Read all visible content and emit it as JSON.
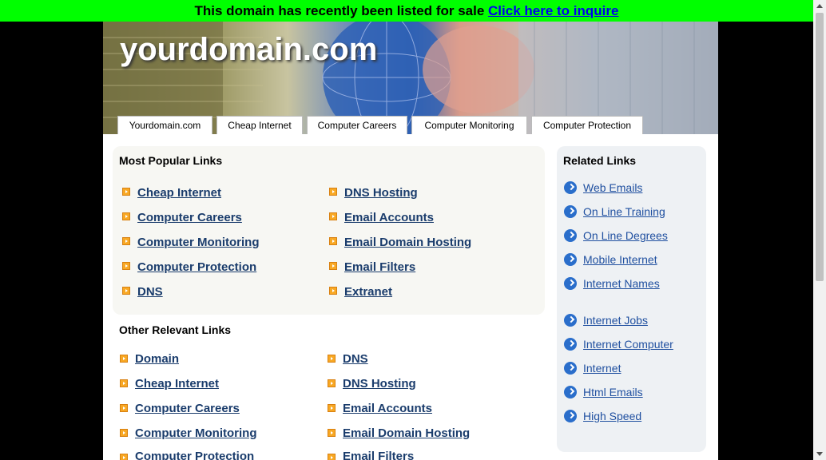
{
  "sale_bar": {
    "text": "This domain has recently been listed for sale",
    "link": "Click here to inquire"
  },
  "site": {
    "title": "yourdomain.com"
  },
  "tabs": [
    "Yourdomain.com",
    "Cheap Internet",
    "Computer Careers",
    "Computer Monitoring",
    "Computer Protection"
  ],
  "popular": {
    "title": "Most Popular Links",
    "left": [
      "Cheap Internet",
      "Computer Careers",
      "Computer Monitoring",
      "Computer Protection",
      "DNS"
    ],
    "right": [
      "DNS Hosting",
      "Email Accounts",
      "Email Domain Hosting",
      "Email Filters",
      "Extranet"
    ]
  },
  "relevant": {
    "title": "Other Relevant Links",
    "left": [
      "Domain",
      "Cheap Internet",
      "Computer Careers",
      "Computer Monitoring",
      "Computer Protection"
    ],
    "right": [
      "DNS",
      "DNS Hosting",
      "Email Accounts",
      "Email Domain Hosting",
      "Email Filters"
    ]
  },
  "related": {
    "title": "Related Links",
    "group1": [
      "Web Emails",
      "On Line Training",
      "On Line Degrees",
      "Mobile Internet",
      "Internet Names "
    ],
    "group2": [
      "Internet Jobs",
      "Internet Computer",
      "Internet",
      "Html Emails",
      "High Speed "
    ]
  },
  "colors": {
    "sale_bar": "#00ff00",
    "link_dark": "#1a3c6c",
    "link_blue": "#2050a0",
    "arrow_orange": "#f8a824",
    "icon_blue": "#2a6ecb"
  }
}
